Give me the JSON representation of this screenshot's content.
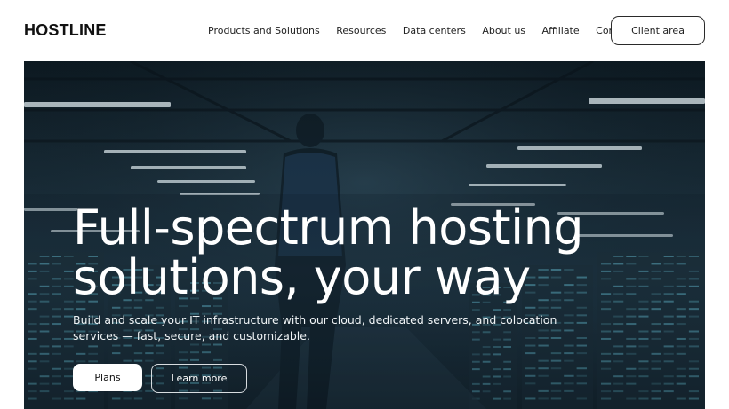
{
  "header": {
    "logo": "HOSTLINE",
    "nav": [
      {
        "label": "Products and Solutions"
      },
      {
        "label": "Resources"
      },
      {
        "label": "Data centers"
      },
      {
        "label": "About us"
      },
      {
        "label": "Affiliate"
      },
      {
        "label": "Contacts"
      }
    ],
    "client_area_label": "Client area"
  },
  "hero": {
    "title_line1": "Full-spectrum hosting",
    "title_line2": "solutions, your way",
    "subtitle": "Build and scale your IT infrastructure with our cloud, dedicated servers, and colocation services — fast, secure, and customizable.",
    "plans_label": "Plans",
    "learn_more_label": "Learn more"
  },
  "colors": {
    "hero_overlay": "#16262f",
    "server_light": "#6fd3e8",
    "ceiling_light": "#e8f4f8"
  }
}
